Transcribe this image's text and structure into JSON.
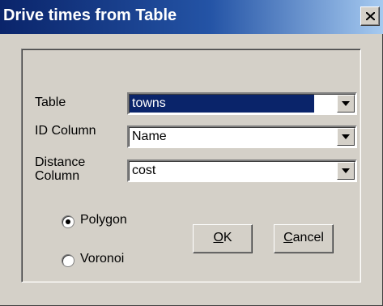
{
  "window": {
    "title": "Drive times from Table",
    "close_icon": "close-x-icon"
  },
  "form": {
    "table_label": "Table",
    "table_value": "towns",
    "id_label": "ID Column",
    "id_value": "Name",
    "distance_label_line1": "Distance",
    "distance_label_line2": "Column",
    "distance_value": "cost"
  },
  "options": {
    "polygon_label": "Polygon",
    "polygon_checked": true,
    "voronoi_label": "Voronoi",
    "voronoi_checked": false
  },
  "buttons": {
    "ok_mnemonic": "O",
    "ok_rest": "K",
    "cancel_mnemonic": "C",
    "cancel_rest": "ancel"
  },
  "colors": {
    "title_bar": "#0a246a",
    "selection": "#0a246a",
    "face": "#d4d0c8"
  }
}
